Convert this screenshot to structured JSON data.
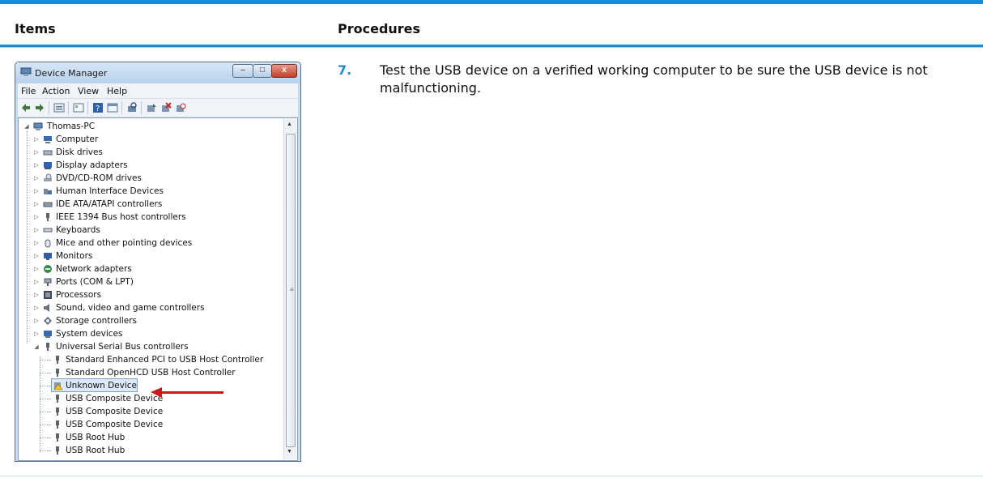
{
  "table": {
    "header_items": "Items",
    "header_procedures": "Procedures"
  },
  "step": {
    "number": "7.",
    "text": "Test the USB device on a verified working computer to be sure the USB device is not malfunctioning."
  },
  "device_manager": {
    "title": "Device Manager",
    "window_buttons": {
      "minimize": "–",
      "maximize": "□",
      "close": "x"
    },
    "menu": [
      "File",
      "Action",
      "View",
      "Help"
    ],
    "root": "Thomas-PC",
    "categories": [
      "Computer",
      "Disk drives",
      "Display adapters",
      "DVD/CD-ROM drives",
      "Human Interface Devices",
      "IDE ATA/ATAPI controllers",
      "IEEE 1394 Bus host controllers",
      "Keyboards",
      "Mice and other pointing devices",
      "Monitors",
      "Network adapters",
      "Ports (COM & LPT)",
      "Processors",
      "Sound, video and game controllers",
      "Storage controllers",
      "System devices",
      "Universal Serial Bus controllers"
    ],
    "usb_children": [
      "Standard Enhanced PCI to USB Host Controller",
      "Standard OpenHCD USB Host Controller",
      "Unknown Device",
      "USB Composite Device",
      "USB Composite Device",
      "USB Composite Device",
      "USB Root Hub",
      "USB Root Hub"
    ],
    "selected_item": "Unknown Device"
  },
  "colors": {
    "accent": "#1e8bd0",
    "callout_arrow": "#cc1a1a"
  }
}
